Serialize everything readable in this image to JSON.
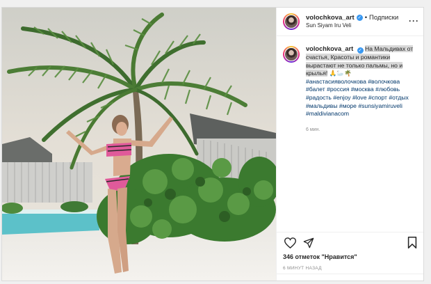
{
  "post": {
    "username": "volochkova_art",
    "follow_label": "Подписки",
    "location": "Sun Siyam Iru Veli",
    "caption_text": "На Мальдивах от счастья, Красоты и романтики вырастают не только пальмы, но и крылья!",
    "caption_emoji": "🙏🦢🌴",
    "hashtags": [
      "#анастасияволочкова",
      "#волочкова",
      "#балет",
      "#россия",
      "#москва",
      "#любовь",
      "#радость",
      "#enjoy",
      "#love",
      "#спорт",
      "#отдых",
      "#мальдивы",
      "#море",
      "#sunsiyamiruveli",
      "#maldivianacom"
    ],
    "age": "6 мин.",
    "likes": "346 отметок \"Нравится\"",
    "timestamp": "6 МИНУТ НАЗАД"
  },
  "icons": {
    "verified": "verified-badge-icon",
    "more": "more-options-icon",
    "like": "heart-icon",
    "share": "paper-plane-icon",
    "save": "bookmark-icon"
  },
  "colors": {
    "verified": "#3897f0",
    "hashtag": "#00376b",
    "text": "#262626",
    "muted": "#8e8e8e",
    "highlight": "#d8d8d8"
  }
}
